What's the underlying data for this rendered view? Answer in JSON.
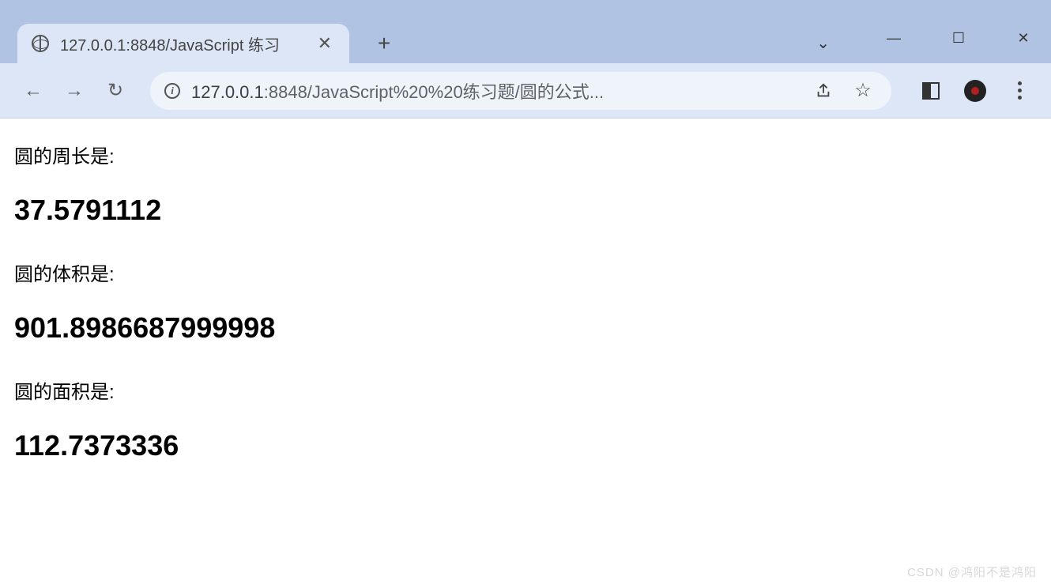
{
  "window": {
    "tab_title": "127.0.0.1:8848/JavaScript  练习",
    "close_glyph": "✕",
    "new_tab_glyph": "+",
    "min_glyph": "—",
    "max_glyph": "☐",
    "winclose_glyph": "✕",
    "chevron_glyph": "⌄"
  },
  "toolbar": {
    "back_glyph": "←",
    "forward_glyph": "→",
    "reload_glyph": "↻",
    "site_info_glyph": "i",
    "url_host": "127.0.0.1",
    "url_port_path": ":8848/JavaScript%20%20练习题/圆的公式...",
    "share_glyph": "⇪",
    "star_glyph": "☆"
  },
  "page": {
    "label_circumference": "圆的周长是:",
    "value_circumference": "37.5791112",
    "label_volume": "圆的体积是:",
    "value_volume": "901.8986687999998",
    "label_area": "圆的面积是:",
    "value_area": "112.7373336"
  },
  "watermark": "CSDN @鸿阳不是鸿阳"
}
